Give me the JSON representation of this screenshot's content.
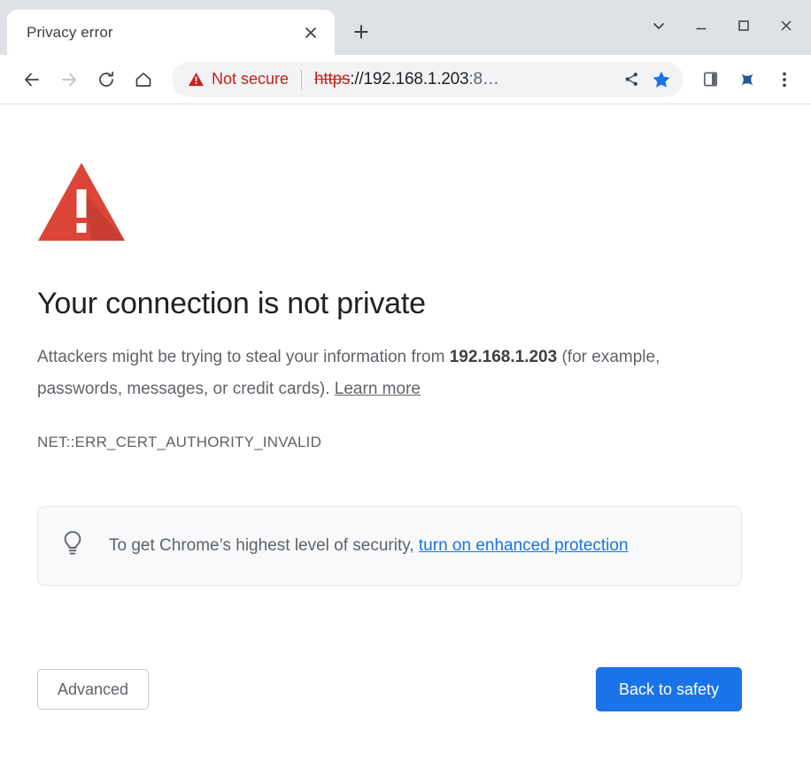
{
  "browser": {
    "tab": {
      "title": "Privacy error",
      "close_icon": "close-icon"
    },
    "new_tab_label": "+",
    "window_controls": {
      "tab_search": "chevron-down-icon",
      "minimize": "minimize-icon",
      "maximize": "maximize-icon",
      "close": "close-icon"
    },
    "nav": {
      "back": "back-arrow-icon",
      "forward": "forward-arrow-icon",
      "reload": "reload-icon",
      "home": "home-icon"
    },
    "omnibox": {
      "security_status": "Not secure",
      "security_icon": "warning-triangle-icon",
      "url_scheme": "https",
      "url_separator": "://",
      "url_host": "192.168.1.203",
      "url_tail": ":8…",
      "share_icon": "share-icon",
      "bookmark_icon": "star-filled-icon"
    },
    "toolbar_icons": {
      "side_panel": "side-panel-icon",
      "extension": "extension-icon",
      "menu": "three-dot-menu-icon"
    },
    "colors": {
      "frame": "#dee1e6",
      "danger_red": "#c5221f",
      "accent_blue": "#1a73e8",
      "bookmark_blue": "#1a73e8"
    }
  },
  "interstitial": {
    "warning_icon": "warning-triangle-icon",
    "warning_icon_color": "#db4437",
    "headline": "Your connection is not private",
    "body_prefix": "Attackers might be trying to steal your information from ",
    "body_host": "192.168.1.203",
    "body_suffix": " (for example, passwords, messages, or credit cards). ",
    "learn_more": "Learn more",
    "error_code": "NET::ERR_CERT_AUTHORITY_INVALID",
    "callout": {
      "icon": "lightbulb-icon",
      "text_prefix": "To get Chrome’s highest level of security, ",
      "link_text": "turn on enhanced protection"
    },
    "buttons": {
      "advanced": "Advanced",
      "back_to_safety": "Back to safety"
    }
  }
}
